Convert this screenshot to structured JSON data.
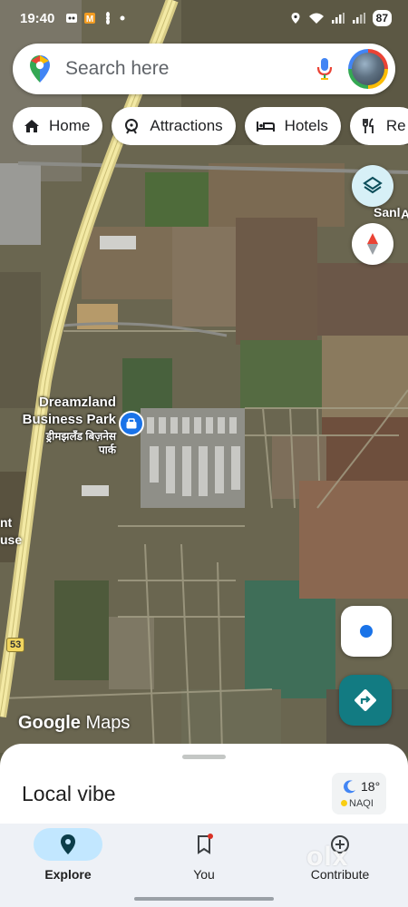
{
  "status_bar": {
    "time": "19:40",
    "battery": "87"
  },
  "search": {
    "placeholder": "Search here"
  },
  "chips": [
    {
      "label": "Home",
      "icon": "home-icon"
    },
    {
      "label": "Attractions",
      "icon": "attractions-icon"
    },
    {
      "label": "Hotels",
      "icon": "hotel-bed-icon"
    },
    {
      "label": "Re",
      "icon": "restaurant-icon"
    }
  ],
  "map": {
    "place_name_en": "Dreamzland Business Park",
    "place_name_hi": "ड्रीमझलँड बिज़नेस पार्क",
    "route_shield": "53",
    "edge_label_top": "h Sanl",
    "edge_label_top_2": "A",
    "edge_label_left": "nt",
    "edge_label_left_2": "use",
    "attribution_brand": "Google",
    "attribution_product": "Maps"
  },
  "sheet": {
    "title": "Local vibe",
    "weather_temp": "18°",
    "weather_aqi": "NAQI"
  },
  "nav": {
    "explore": "Explore",
    "you": "You",
    "contribute": "Contribute"
  },
  "watermark": "olx",
  "colors": {
    "accent_blue": "#1a73e8",
    "directions_teal": "#127b82",
    "nav_active": "#c2e7ff"
  }
}
